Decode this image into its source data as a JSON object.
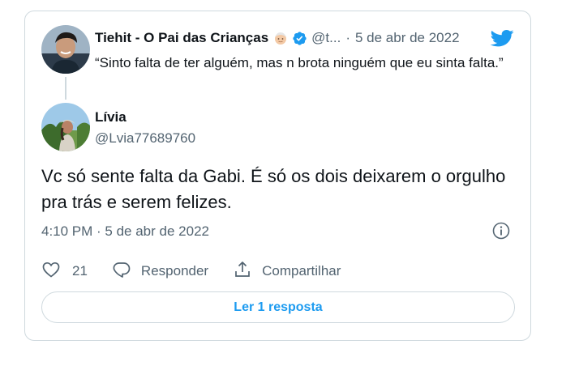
{
  "quoted_tweet": {
    "name": "Tiehit - O Pai das Crianças",
    "handle": "@t...",
    "separator": "·",
    "date": "5 de abr de 2022",
    "text": "“Sinto falta de ter alguém, mas n brota ninguém que eu sinta falta.”"
  },
  "reply": {
    "name": "Lívia",
    "handle": "@Lvia77689760",
    "text": "Vc só sente falta da Gabi. É só os dois deixarem o orgulho pra trás e serem felizes.",
    "timestamp": "4:10 PM · 5 de abr de 2022"
  },
  "actions": {
    "like_count": "21",
    "reply_label": "Responder",
    "share_label": "Compartilhar"
  },
  "read_replies_label": "Ler 1 resposta",
  "colors": {
    "brand_blue": "#1d9bf0",
    "secondary_text": "#536471",
    "border": "#cfd9de"
  },
  "icons": [
    "verified-badge-icon",
    "older-person-emoji-icon",
    "twitter-bird-icon",
    "info-icon",
    "heart-icon",
    "reply-bubble-icon",
    "share-icon"
  ]
}
